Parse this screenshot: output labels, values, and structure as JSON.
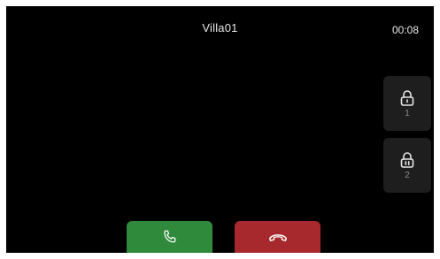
{
  "call": {
    "caller_name": "Villa01",
    "elapsed": "00:08"
  },
  "unlock_buttons": [
    {
      "label": "1",
      "icon": "lock-open-icon"
    },
    {
      "label": "2",
      "icon": "lock-pause-icon"
    }
  ],
  "actions": {
    "answer_icon": "phone-icon",
    "hangup_icon": "phone-hangup-icon"
  },
  "colors": {
    "background": "#000000",
    "answer": "#2f8a3c",
    "hangup": "#a8292d",
    "tile": "#1e1e1e"
  }
}
